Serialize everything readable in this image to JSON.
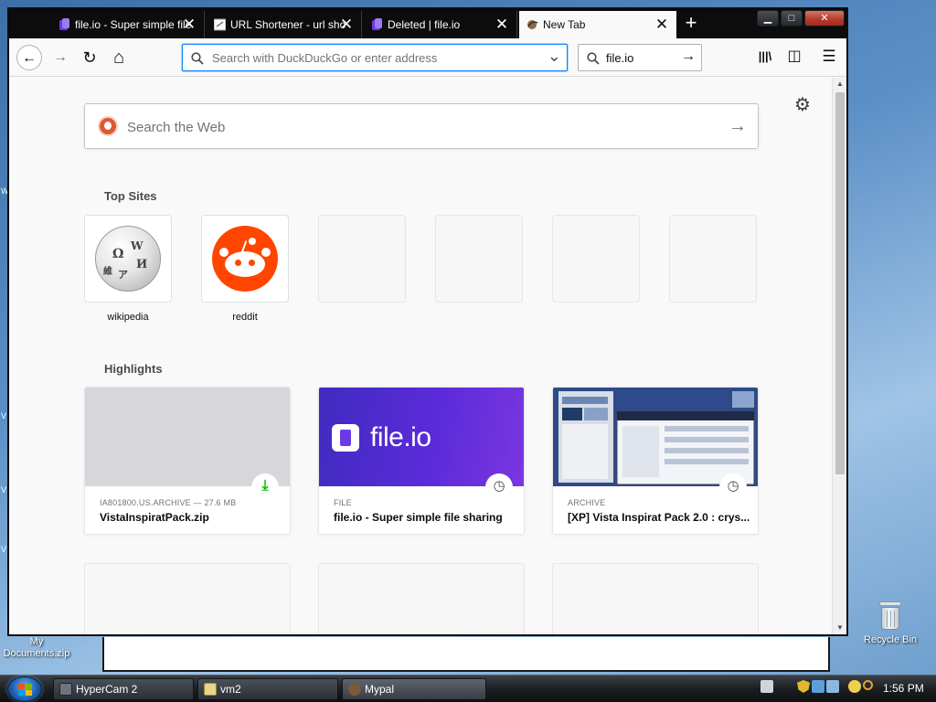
{
  "desktop": {
    "edge_marks": [
      "W",
      "V",
      "V",
      "V"
    ],
    "icons": [
      {
        "label_line1": "My",
        "label_line2": "Documents.zip"
      },
      {
        "label": "Recycle Bin"
      }
    ]
  },
  "taskbar": {
    "buttons": [
      {
        "label": "HyperCam 2"
      },
      {
        "label": "vm2"
      },
      {
        "label": "Mypal"
      }
    ],
    "clock": "1:56 PM"
  },
  "browser": {
    "tabs": [
      {
        "label": "file.io - Super simple file",
        "close": "✕"
      },
      {
        "label": "URL Shortener - url sho",
        "close": "✕"
      },
      {
        "label": "Deleted | file.io",
        "close": "✕"
      },
      {
        "label": "New Tab",
        "close": "✕",
        "active": true
      }
    ],
    "new_tab": "+",
    "window_controls": {
      "minimize": "▁",
      "maximize": "□",
      "close": "✕"
    },
    "urlbar": {
      "placeholder": "Search with DuckDuckGo or enter address",
      "value": ""
    },
    "searchbar": {
      "value": "file.io"
    },
    "toolbar": {
      "back": "←",
      "forward": "→",
      "reload": "↻",
      "home": "⌂",
      "library": "|||\\",
      "sidebar": "◫",
      "menu": "☰",
      "go": "→",
      "dropdown": "⌄"
    }
  },
  "newtab": {
    "search": {
      "placeholder": "Search the Web",
      "go": "→"
    },
    "top_sites_title": "Top Sites",
    "top_sites": [
      {
        "label": "wikipedia"
      },
      {
        "label": "reddit"
      },
      {
        "label": ""
      },
      {
        "label": ""
      },
      {
        "label": ""
      },
      {
        "label": ""
      }
    ],
    "highlights_title": "Highlights",
    "highlights": [
      {
        "type": "IA801800.US.ARCHIVE — 27.6 MB",
        "title": "VistaInspiratPack.zip"
      },
      {
        "type": "FILE",
        "title": "file.io - Super simple file sharing",
        "logo_text": "file.io"
      },
      {
        "type": "ARCHIVE",
        "title": "[XP] Vista Inspirat Pack 2.0 : crys..."
      }
    ]
  },
  "colors": {
    "accent": "#0a84ff",
    "reddit": "#ff4500",
    "fileio": "#5b2bd9",
    "download": "#12bc00"
  }
}
